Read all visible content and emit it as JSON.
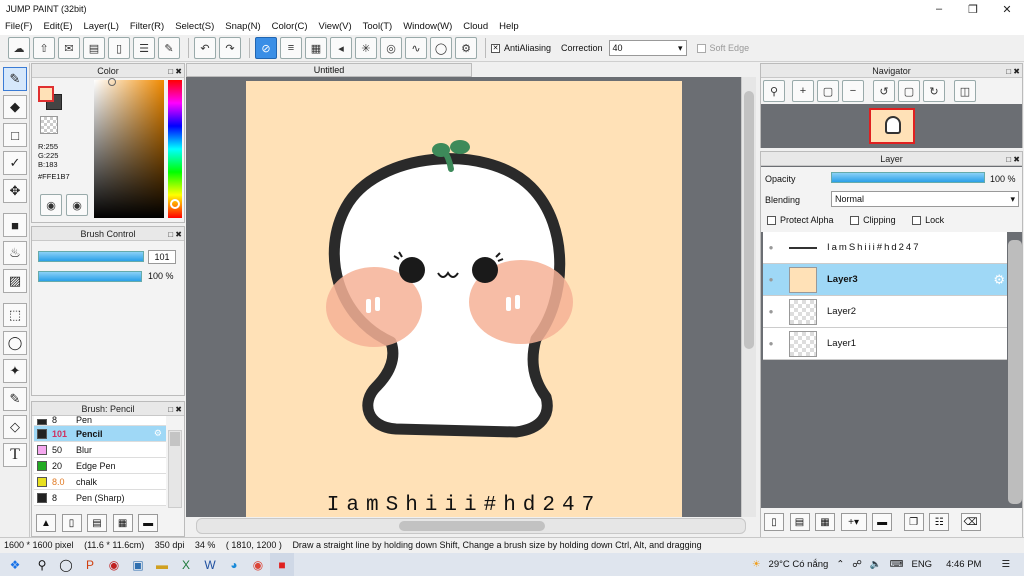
{
  "window": {
    "title": "JUMP PAINT (32bit)"
  },
  "menu": [
    "File(F)",
    "Edit(E)",
    "Layer(L)",
    "Filter(R)",
    "Select(S)",
    "Snap(N)",
    "Color(C)",
    "View(V)",
    "Tool(T)",
    "Window(W)",
    "Cloud",
    "Help"
  ],
  "toolbar": {
    "antialiasing_label": "AntiAliasing",
    "correction_label": "Correction",
    "correction_value": "40",
    "soft_edge_label": "Soft Edge"
  },
  "color_panel": {
    "title": "Color",
    "r": "R:255",
    "g": "G:225",
    "b": "B:183",
    "hex": "#FFE1B7"
  },
  "brush_control": {
    "title": "Brush Control",
    "size": "101",
    "opacity": "100 %"
  },
  "brush_panel": {
    "title": "Brush: Pencil",
    "rows": [
      {
        "size": "8",
        "name": "Pen",
        "color": "#222222"
      },
      {
        "size": "101",
        "name": "Pencil",
        "color": "#222222"
      },
      {
        "size": "50",
        "name": "Blur",
        "color": "#f5a8ef"
      },
      {
        "size": "20",
        "name": "Edge Pen",
        "color": "#22aa22"
      },
      {
        "size": "8.0",
        "name": "chalk",
        "color": "#e8e020"
      },
      {
        "size": "8",
        "name": "Pen (Sharp)",
        "color": "#222222"
      }
    ]
  },
  "document": {
    "tab_title": "Untitled",
    "canvas_text": "IamShiii#hd247",
    "canvas_bg": "#FFE1B7"
  },
  "navigator": {
    "title": "Navigator"
  },
  "layer_panel": {
    "title": "Layer",
    "opacity_label": "Opacity",
    "opacity_value": "100 %",
    "blending_label": "Blending",
    "blending_value": "Normal",
    "protect_alpha": "Protect Alpha",
    "clipping": "Clipping",
    "lock": "Lock",
    "layers": [
      {
        "name": "IamShiii#hd247"
      },
      {
        "name": "Layer3"
      },
      {
        "name": "Layer2"
      },
      {
        "name": "Layer1"
      }
    ]
  },
  "status": {
    "size": "1600 * 1600 pixel",
    "cm": "(11.6 * 11.6cm)",
    "dpi": "350 dpi",
    "zoom": "34 %",
    "coords": "( 1810, 1200 )",
    "hint": "Draw a straight line by holding down Shift, Change a brush size by holding down Ctrl, Alt, and dragging"
  },
  "taskbar": {
    "weather": "29°C  Có nắng",
    "lang": "ENG",
    "time": "4:46 PM"
  }
}
